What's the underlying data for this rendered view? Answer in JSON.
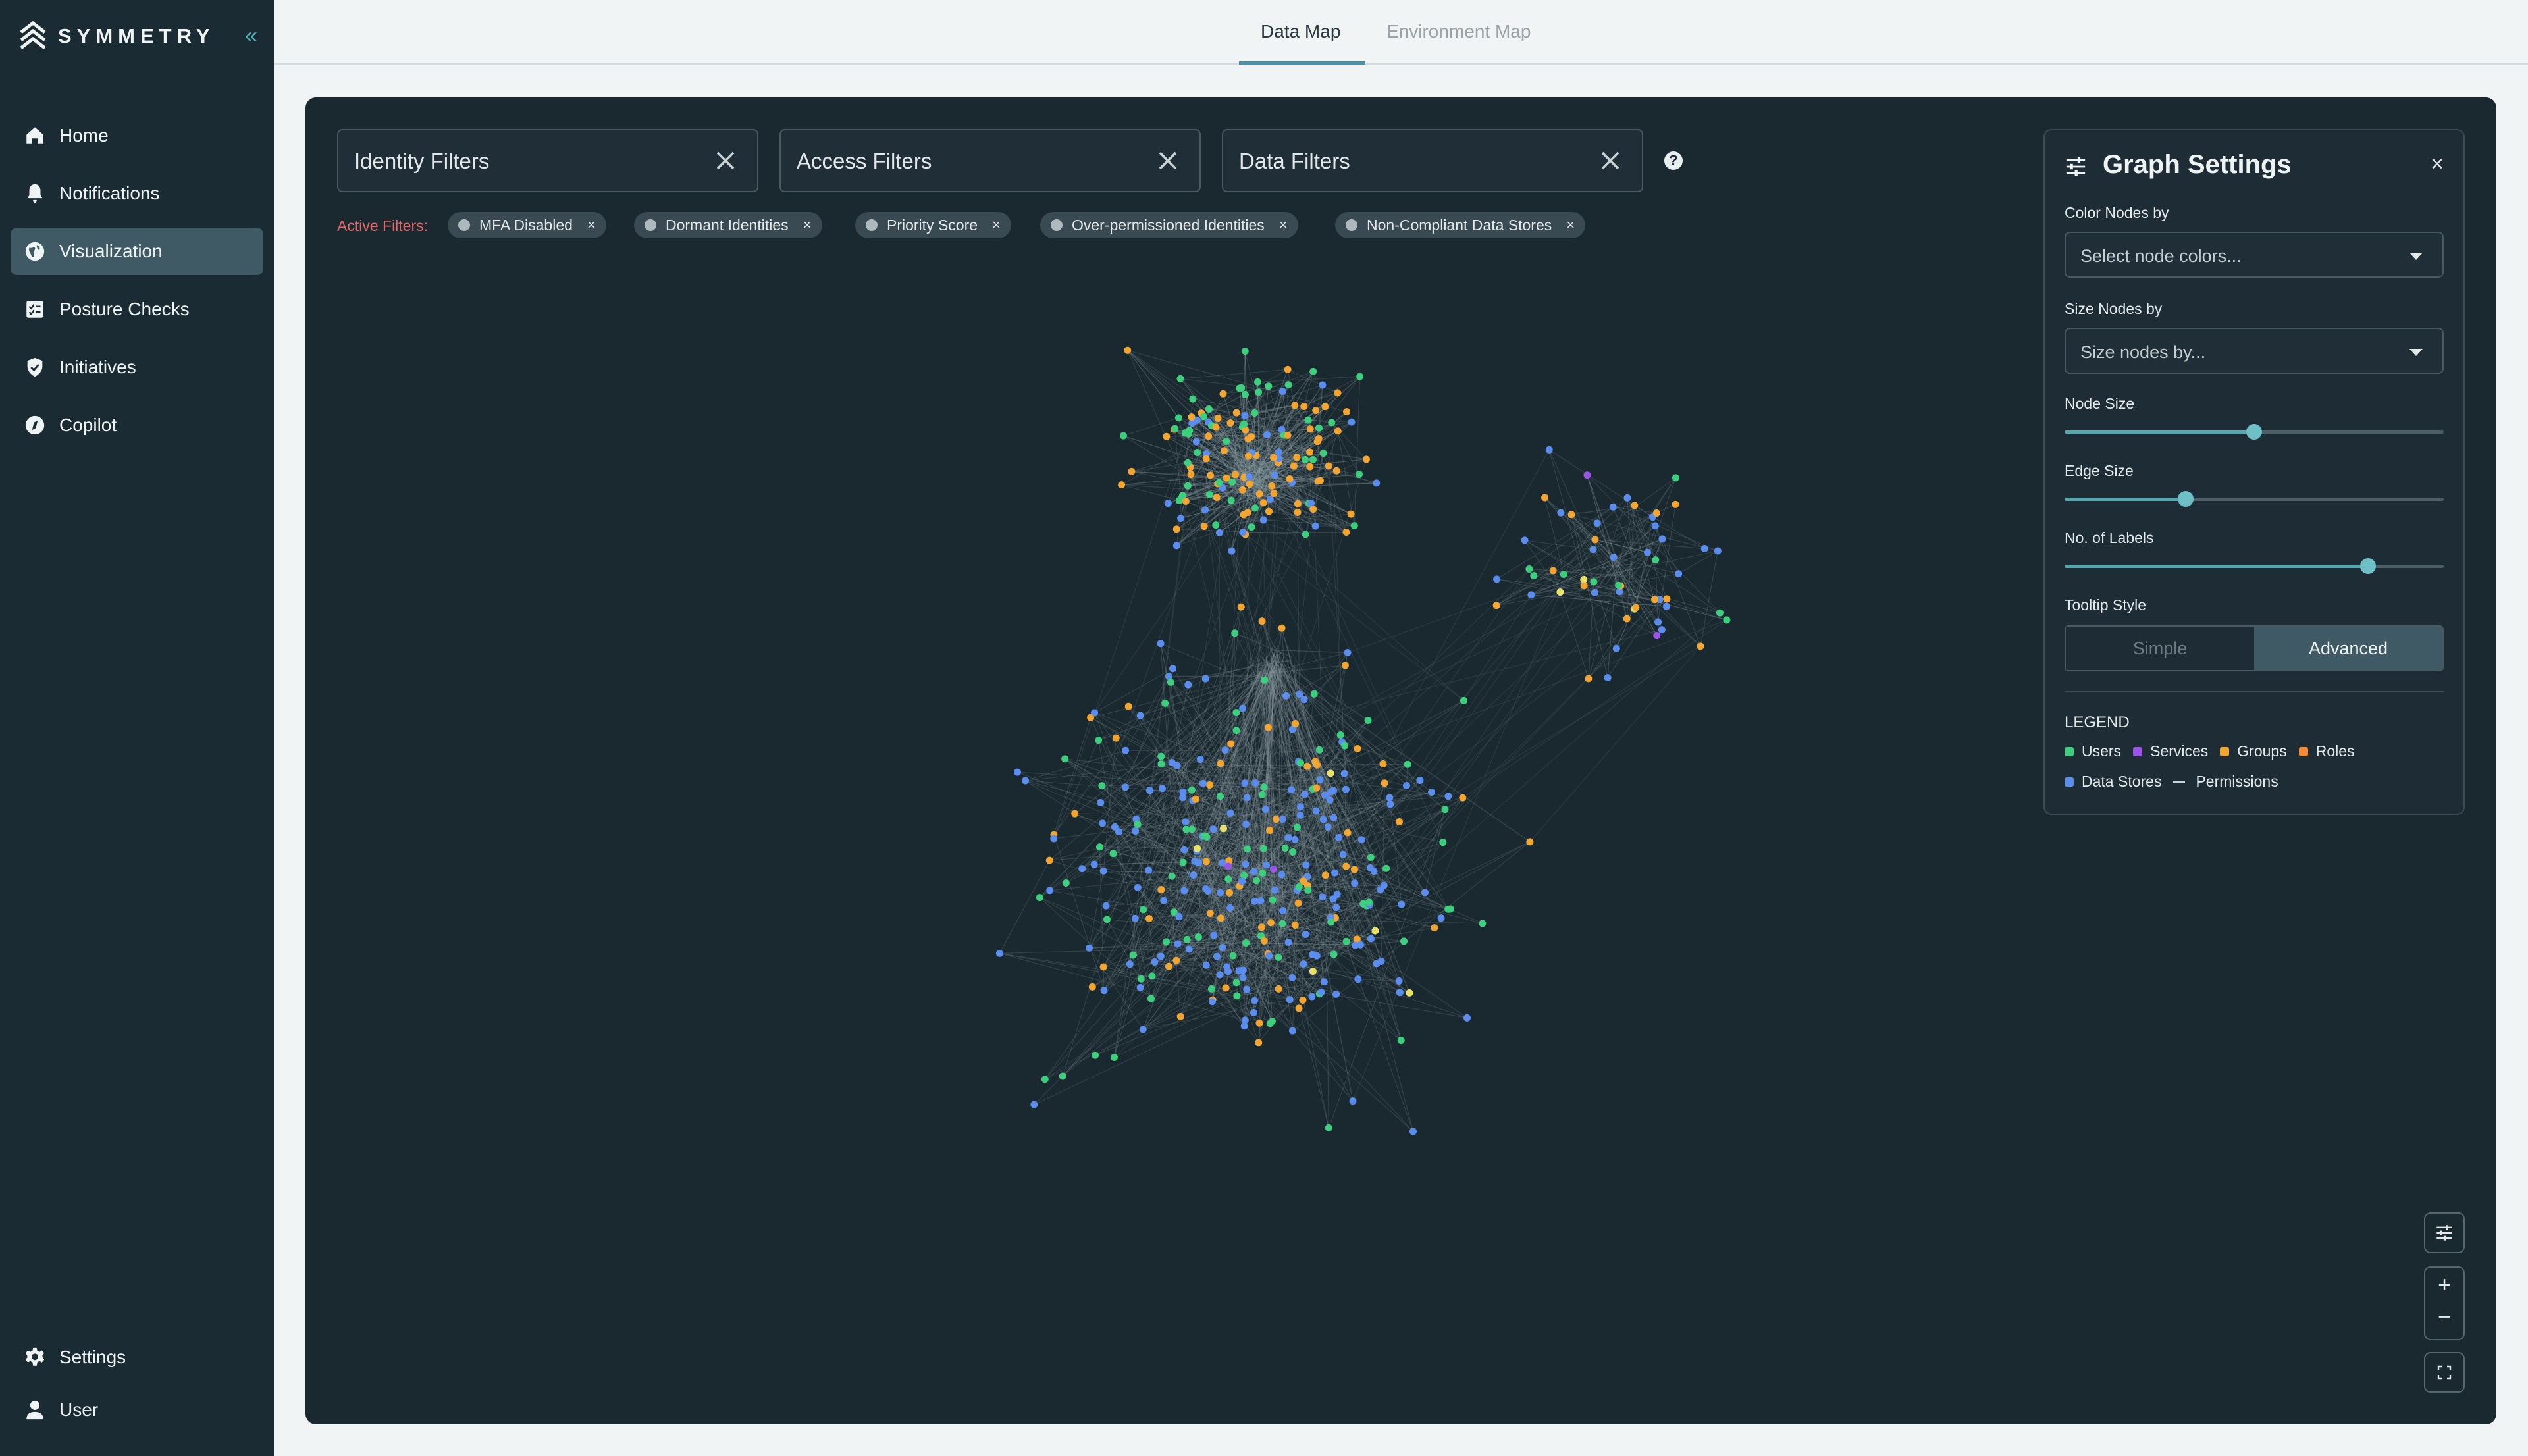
{
  "app": {
    "brand": "SYMMETRY"
  },
  "sidebar": {
    "items": [
      {
        "label": "Home",
        "icon": "home-icon"
      },
      {
        "label": "Notifications",
        "icon": "bell-icon"
      },
      {
        "label": "Visualization",
        "icon": "globe-icon",
        "active": true
      },
      {
        "label": "Posture Checks",
        "icon": "checklist-icon"
      },
      {
        "label": "Initiatives",
        "icon": "shield-check-icon"
      },
      {
        "label": "Copilot",
        "icon": "copilot-icon"
      }
    ],
    "bottom": [
      {
        "label": "Settings",
        "icon": "gear-icon"
      },
      {
        "label": "User",
        "icon": "user-icon"
      }
    ]
  },
  "tabs": [
    {
      "label": "Data Map",
      "active": true
    },
    {
      "label": "Environment Map",
      "active": false
    }
  ],
  "filters": {
    "identity": "Identity Filters",
    "access": "Access Filters",
    "data": "Data Filters",
    "active_label": "Active Filters:",
    "chips": [
      "MFA Disabled",
      "Dormant Identities",
      "Priority Score",
      "Over-permissioned Identities",
      "Non-Compliant Data Stores"
    ]
  },
  "settings": {
    "title": "Graph Settings",
    "color_nodes_label": "Color Nodes by",
    "color_nodes_placeholder": "Select node colors...",
    "size_nodes_label": "Size Nodes by",
    "size_nodes_placeholder": "Size nodes by...",
    "node_size_label": "Node Size",
    "node_size_value": 0.5,
    "edge_size_label": "Edge Size",
    "edge_size_value": 0.32,
    "labels_label": "No. of Labels",
    "labels_value": 0.8,
    "tooltip_label": "Tooltip Style",
    "tooltip_simple": "Simple",
    "tooltip_advanced": "Advanced",
    "tooltip_selected": "Advanced",
    "legend_title": "LEGEND",
    "legend": [
      {
        "label": "Users",
        "color": "#3ecf7e"
      },
      {
        "label": "Services",
        "color": "#9b54e8"
      },
      {
        "label": "Groups",
        "color": "#f2a531"
      },
      {
        "label": "Roles",
        "color": "#f38a3a"
      },
      {
        "label": "Data Stores",
        "color": "#5b8def"
      }
    ],
    "legend_line": "Permissions"
  },
  "colors": {
    "users": "#3ecf7e",
    "groups": "#f2a531",
    "datastores": "#5b8def",
    "services": "#9b54e8",
    "other": "#e8e26a",
    "edge": "#8a9aa0"
  }
}
